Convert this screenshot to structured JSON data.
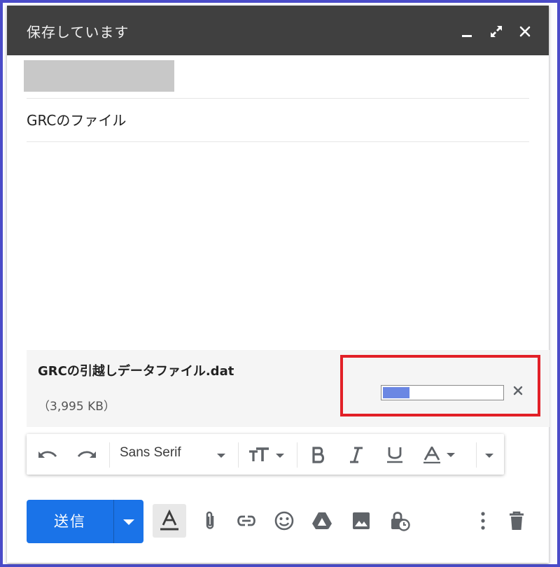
{
  "window": {
    "title": "保存しています",
    "controls": [
      "minimize-icon",
      "expand-icon",
      "close-icon"
    ]
  },
  "subject": "GRCのファイル",
  "attachment": {
    "filename": "GRCの引越しデータファイル.dat",
    "size": "（3,995 KB）",
    "upload_progress_percent": 23,
    "progress_color": "#6b87e3",
    "highlight_color": "#e22027"
  },
  "format_toolbar": {
    "font_family": "Sans Serif",
    "icons": [
      "undo-icon",
      "redo-icon",
      "font-dropdown-icon",
      "text-size-icon",
      "bold-icon",
      "italic-icon",
      "underline-icon",
      "text-color-icon",
      "more-formatting-icon"
    ]
  },
  "bottom_toolbar": {
    "send_label": "送信",
    "icons": [
      "formatting-toggle-icon",
      "attach-icon",
      "link-icon",
      "emoji-icon",
      "drive-icon",
      "photo-icon",
      "confidential-mode-icon",
      "more-options-icon",
      "trash-icon"
    ]
  },
  "colors": {
    "titlebar": "#404040",
    "send_button": "#1a73e8",
    "frame_border": "#4a4bc8"
  }
}
